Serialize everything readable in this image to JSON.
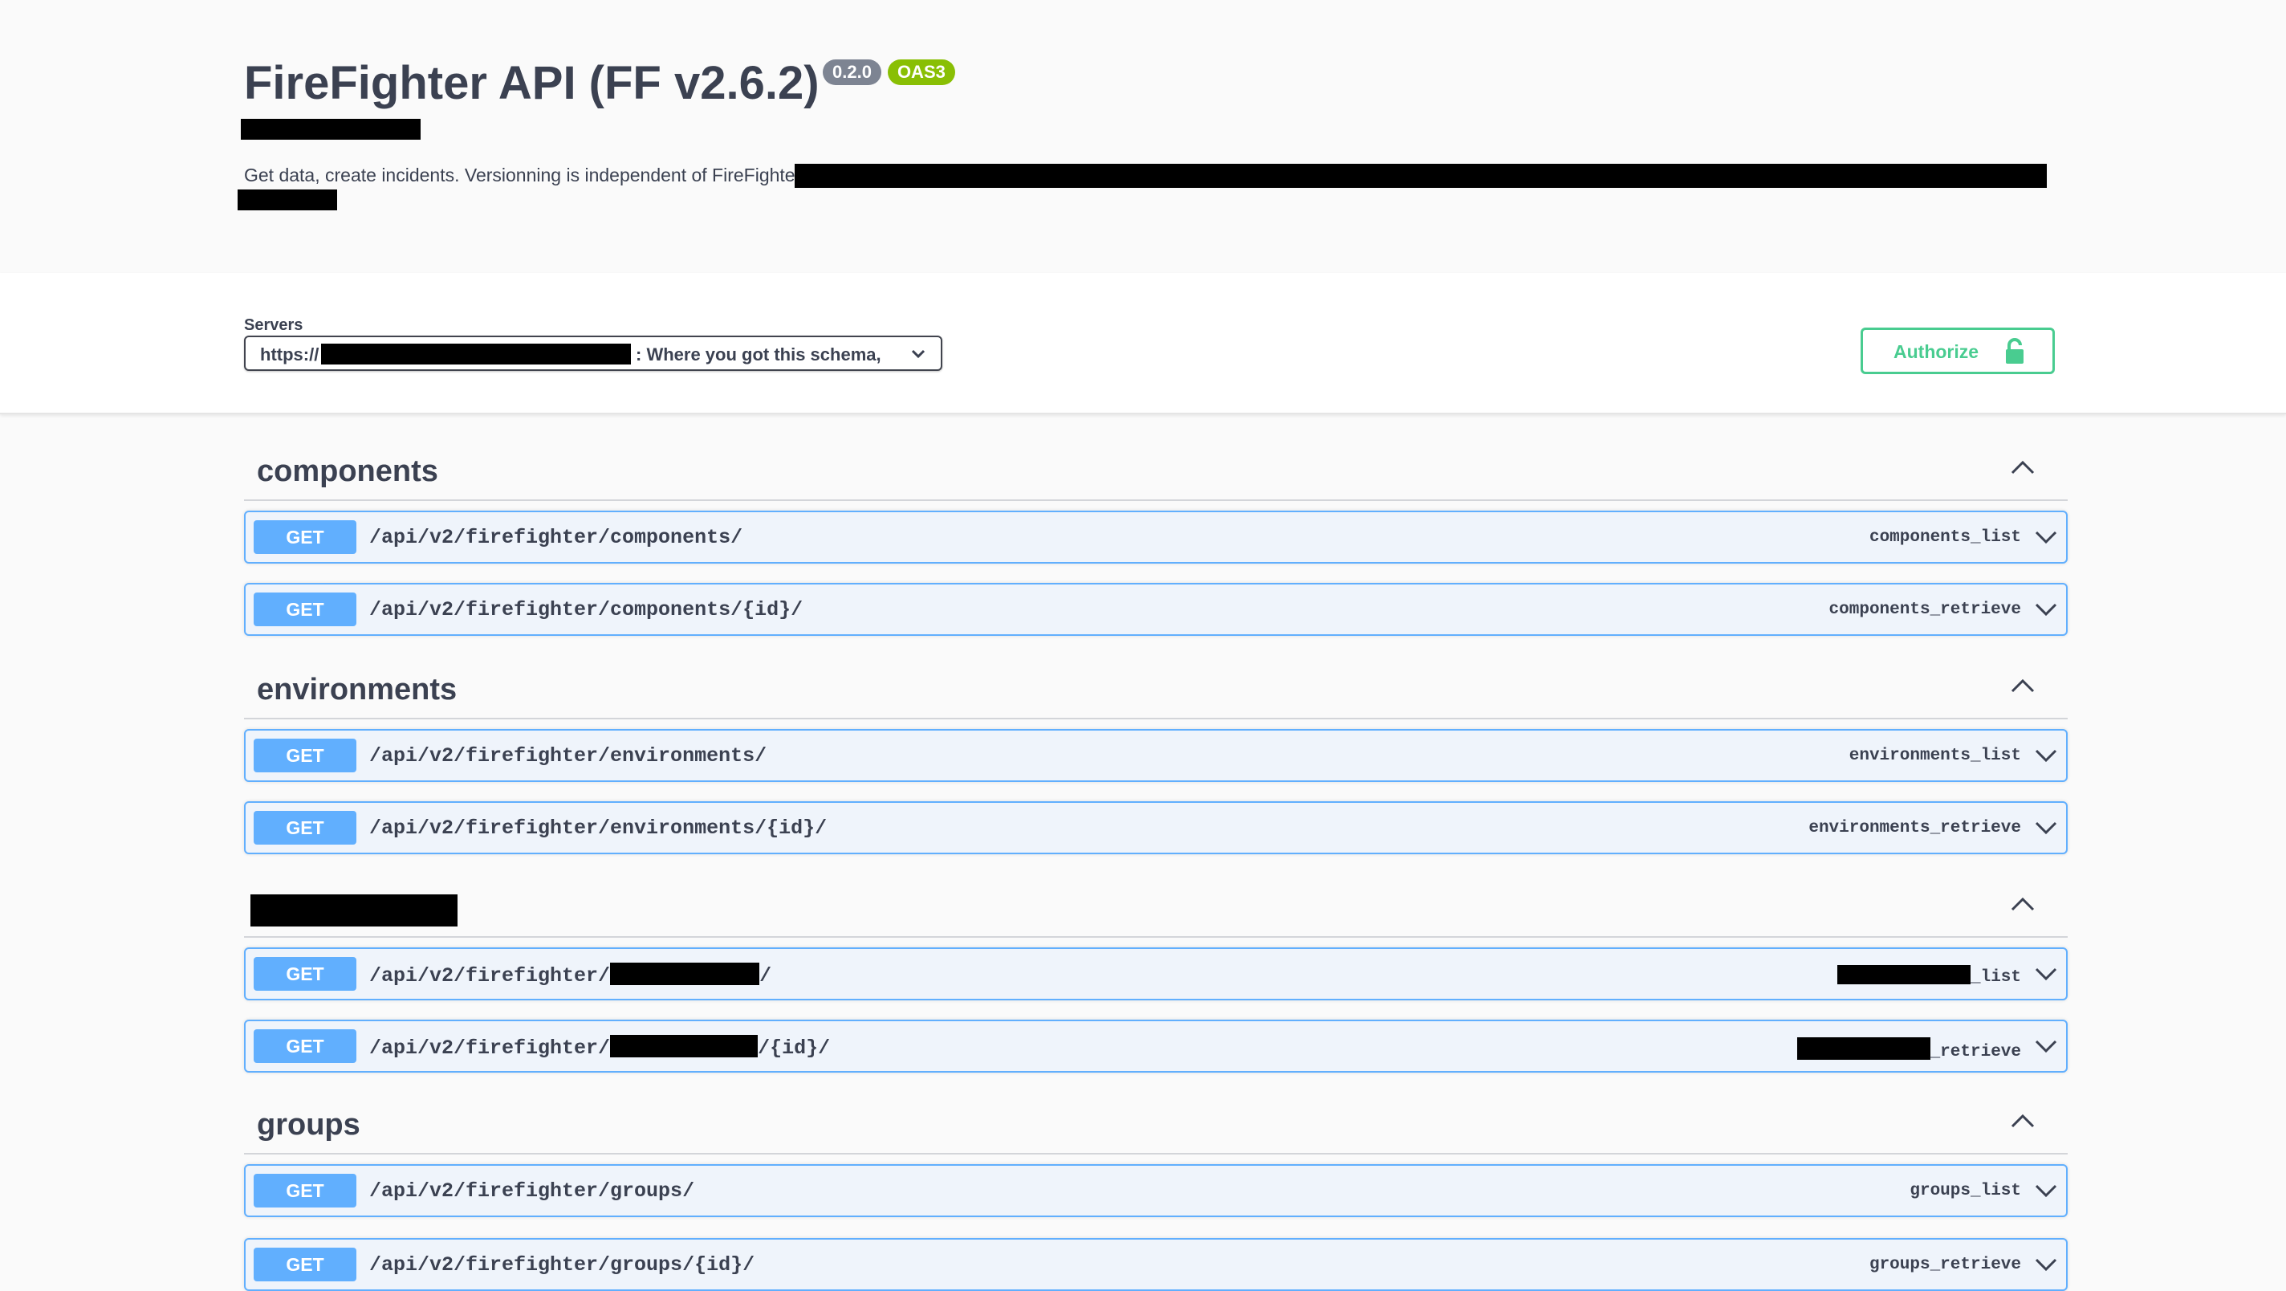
{
  "info": {
    "title": "FireFighter API (FF v2.6.2)",
    "version_badge": "0.2.0",
    "oas_badge": "OAS3",
    "description": "Get data, create incidents. Versionning is independent of FireFighter."
  },
  "servers": {
    "label": "Servers",
    "selected_prefix": "https://",
    "selected_suffix": ": Where you got this schema,"
  },
  "authorize": {
    "label": "Authorize"
  },
  "tags": [
    {
      "name": "components",
      "operations": [
        {
          "method": "GET",
          "path": "/api/v2/firefighter/components/",
          "operation_id": "components_list"
        },
        {
          "method": "GET",
          "path": "/api/v2/firefighter/components/{id}/",
          "operation_id": "components_retrieve"
        }
      ]
    },
    {
      "name": "environments",
      "operations": [
        {
          "method": "GET",
          "path": "/api/v2/firefighter/environments/",
          "operation_id": "environments_list"
        },
        {
          "method": "GET",
          "path": "/api/v2/firefighter/environments/{id}/",
          "operation_id": "environments_retrieve"
        }
      ]
    },
    {
      "name": "",
      "operations": [
        {
          "method": "GET",
          "path_prefix": "/api/v2/firefighter/",
          "path_suffix": "/",
          "operation_id_suffix": "_list"
        },
        {
          "method": "GET",
          "path_prefix": "/api/v2/firefighter/",
          "path_suffix": "/{id}/",
          "operation_id_suffix": "_retrieve"
        }
      ]
    },
    {
      "name": "groups",
      "operations": [
        {
          "method": "GET",
          "path": "/api/v2/firefighter/groups/",
          "operation_id": "groups_list"
        },
        {
          "method": "GET",
          "path": "/api/v2/firefighter/groups/{id}/",
          "operation_id": "groups_retrieve"
        }
      ]
    }
  ],
  "colors": {
    "get": "#61affe",
    "get_bg": "#eff4fb",
    "authorize": "#49cc90",
    "oas": "#89bf04",
    "version": "#7d8492"
  }
}
